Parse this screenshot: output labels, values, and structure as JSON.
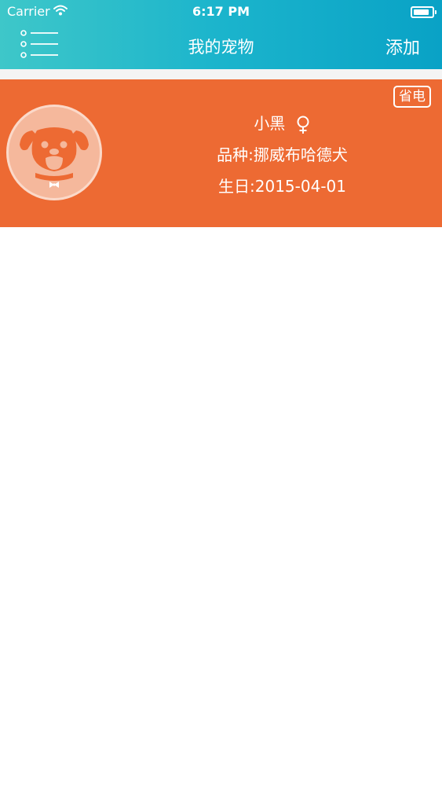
{
  "status_bar": {
    "carrier": "Carrier",
    "time": "6:17 PM",
    "battery_level": 0.88
  },
  "nav": {
    "menu_icon": "list-menu-icon",
    "title": "我的宠物",
    "add_label": "添加"
  },
  "pets": [
    {
      "name": "小黑",
      "gender_icon": "female-icon",
      "breed": "品种:挪威布哈德犬",
      "birthday": "生日:2015-04-01",
      "badge": "省电",
      "avatar_icon": "dog-avatar-icon",
      "card_color": "#ed6a33"
    }
  ],
  "colors": {
    "header_gradient_start": "#3ec7c9",
    "header_gradient_end": "#09a2c6",
    "card": "#ed6a33",
    "avatar_bg": "#f5b89c"
  }
}
